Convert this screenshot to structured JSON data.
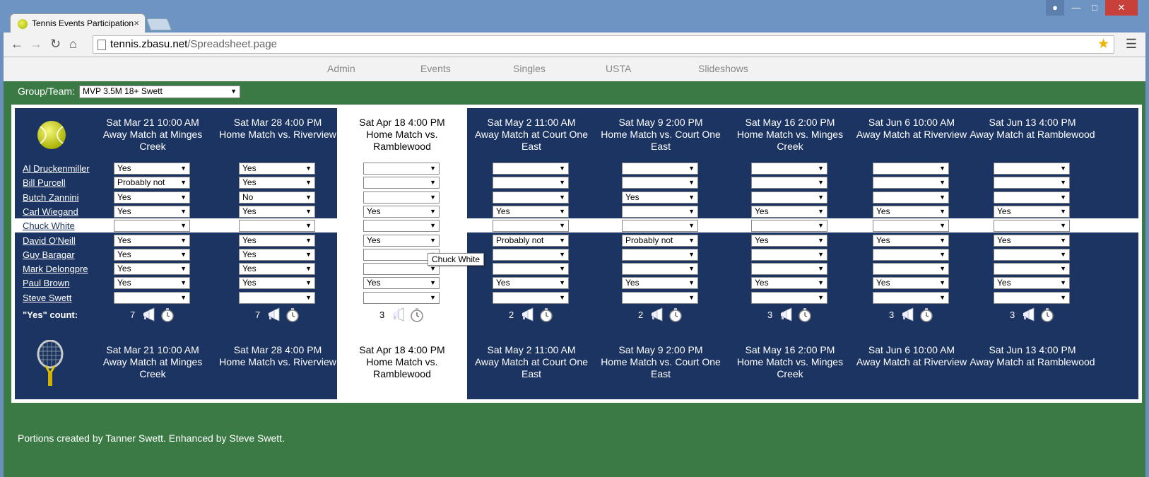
{
  "browser": {
    "tab_title": "Tennis Events Participation",
    "close_glyph": "×",
    "url_domain": "tennis.zbasu.net",
    "url_path": "/Spreadsheet.page"
  },
  "nav": [
    "Admin",
    "Events",
    "Singles",
    "USTA",
    "Slideshows"
  ],
  "group": {
    "label": "Group/Team:",
    "value": "MVP 3.5M 18+ Swett"
  },
  "events": [
    {
      "date": "Sat Mar 21 10:00 AM",
      "lines": [
        "Away Match at Minges",
        "Creek"
      ]
    },
    {
      "date": "Sat Mar 28 4:00 PM",
      "lines": [
        "Home Match vs. Riverview"
      ]
    },
    {
      "date": "Sat Apr 18 4:00 PM",
      "lines": [
        "Home Match vs.",
        "Ramblewood"
      ]
    },
    {
      "date": "Sat May 2 11:00 AM",
      "lines": [
        "Away Match at Court One",
        "East"
      ]
    },
    {
      "date": "Sat May 9 2:00 PM",
      "lines": [
        "Home Match vs. Court One",
        "East"
      ]
    },
    {
      "date": "Sat May 16 2:00 PM",
      "lines": [
        "Home Match vs. Minges",
        "Creek"
      ]
    },
    {
      "date": "Sat Jun 6 10:00 AM",
      "lines": [
        "Away Match at Riverview"
      ]
    },
    {
      "date": "Sat Jun 13 4:00 PM",
      "lines": [
        "Away Match at Ramblewood"
      ]
    }
  ],
  "players": [
    {
      "name": "Al Druckenmiller",
      "responses": [
        "Yes",
        "Yes",
        "",
        "",
        "",
        "",
        "",
        ""
      ]
    },
    {
      "name": "Bill Purcell",
      "responses": [
        "Probably not",
        "Yes",
        "",
        "",
        "",
        "",
        "",
        ""
      ]
    },
    {
      "name": "Butch Zannini",
      "responses": [
        "Yes",
        "No",
        "",
        "",
        "Yes",
        "",
        "",
        ""
      ]
    },
    {
      "name": "Carl Wiegand",
      "responses": [
        "Yes",
        "Yes",
        "Yes",
        "Yes",
        "",
        "Yes",
        "Yes",
        "Yes"
      ]
    },
    {
      "name": "Chuck White",
      "responses": [
        "",
        "",
        "",
        "",
        "",
        "",
        "",
        ""
      ]
    },
    {
      "name": "David O'Neill",
      "responses": [
        "Yes",
        "Yes",
        "Yes",
        "Probably not",
        "Probably not",
        "Yes",
        "Yes",
        "Yes"
      ]
    },
    {
      "name": "Guy Baragar",
      "responses": [
        "Yes",
        "Yes",
        "",
        "",
        "",
        "",
        "",
        ""
      ]
    },
    {
      "name": "Mark Delongpre",
      "responses": [
        "Yes",
        "Yes",
        "",
        "",
        "",
        "",
        "",
        ""
      ]
    },
    {
      "name": "Paul Brown",
      "responses": [
        "Yes",
        "Yes",
        "Yes",
        "Yes",
        "Yes",
        "Yes",
        "Yes",
        "Yes"
      ]
    },
    {
      "name": "Steve Swett",
      "responses": [
        "",
        "",
        "",
        "",
        "",
        "",
        "",
        ""
      ]
    }
  ],
  "yes_count_label": "\"Yes\" count:",
  "yes_counts": [
    "7",
    "7",
    "3",
    "2",
    "2",
    "3",
    "3",
    "3"
  ],
  "tooltip": "Chuck White",
  "footer": "Portions created by Tanner Swett. Enhanced by Steve Swett."
}
